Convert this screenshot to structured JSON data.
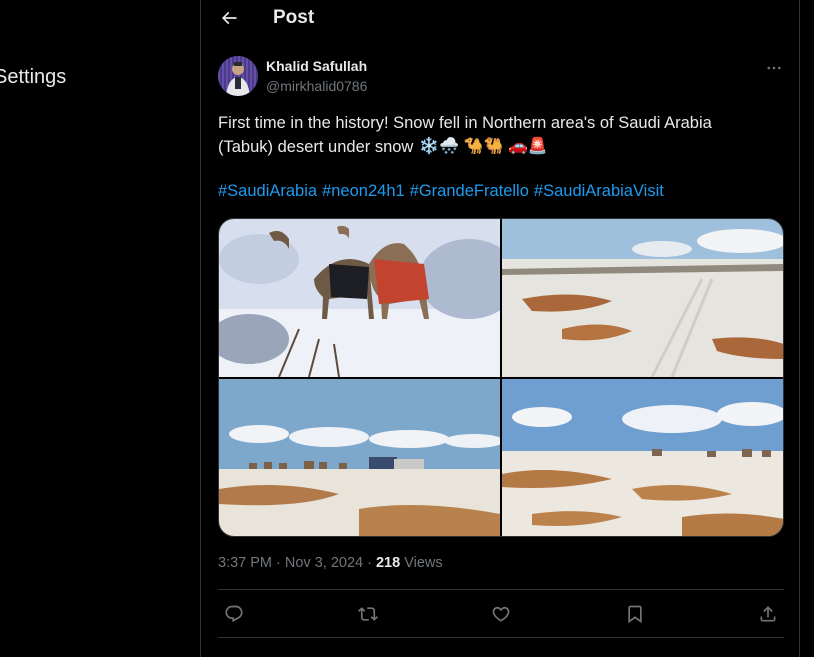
{
  "sidebar": {
    "settings_label": "Settings"
  },
  "header": {
    "title": "Post"
  },
  "post": {
    "author_name": "Khalid Safullah",
    "author_handle": "@mirkhalid0786",
    "text_line1": "First time in the history! Snow fell in Northern area's of Saudi Arabia",
    "text_line2": "(Tabuk) desert under snow",
    "text_emojis": "❄️🌨️ 🐪🐫 🚗🚨",
    "hashtags": [
      "#SaudiArabia",
      "#neon24h1",
      "#GrandeFratello",
      "#SaudiArabiaVisit"
    ],
    "timestamp": "3:37 PM · Nov 3, 2024 · ",
    "views_count": "218",
    "views_label": " Views"
  },
  "icons": {
    "back": "arrow-left-icon",
    "more": "more-horizontal-icon",
    "reply": "reply-icon",
    "repost": "repost-icon",
    "like": "heart-icon",
    "bookmark": "bookmark-icon",
    "share": "share-icon"
  },
  "colors": {
    "background": "#000000",
    "text": "#e7e9ea",
    "muted": "#71767b",
    "accent": "#1d9bf0",
    "border": "#2f3336"
  }
}
